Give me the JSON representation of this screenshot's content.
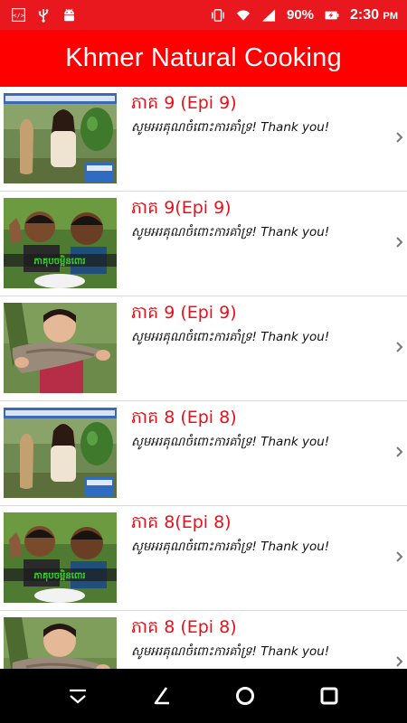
{
  "status_bar": {
    "battery_percent": "90%",
    "time": "2:30",
    "ampm": "PM",
    "icons": [
      "code-icon",
      "usb-icon",
      "android-icon",
      "vibrate-icon",
      "wifi-icon",
      "signal-icon",
      "battery-charging-icon"
    ]
  },
  "app_bar": {
    "title": "Khmer Natural Cooking"
  },
  "colors": {
    "status_bar": "#e8181e",
    "app_bar": "#fe0000",
    "title_text": "#e8101a"
  },
  "episodes": [
    {
      "title": "ភាគ 9 (Epi 9)",
      "subtitle": "សូមអរគុណចំពោះការគាំទ្រ! Thank you!",
      "thumbnail": "woman-papaya"
    },
    {
      "title": "ភាគ 9(Epi 9)",
      "subtitle": "សូមអរគុណចំពោះការគាំទ្រ! Thank you!",
      "thumbnail": "two-boys"
    },
    {
      "title": "ភាគ 9 (Epi 9)",
      "subtitle": "សូមអរគុណចំពោះការគាំទ្រ! Thank you!",
      "thumbnail": "woman-fish"
    },
    {
      "title": "ភាគ 8 (Epi 8)",
      "subtitle": "សូមអរគុណចំពោះការគាំទ្រ! Thank you!",
      "thumbnail": "woman-papaya"
    },
    {
      "title": "ភាគ 8(Epi 8)",
      "subtitle": "សូមអរគុណចំពោះការគាំទ្រ! Thank you!",
      "thumbnail": "two-boys"
    },
    {
      "title": "ភាគ 8 (Epi 8)",
      "subtitle": "សូមអរគុណចំពោះការគាំទ្រ! Thank you!",
      "thumbnail": "woman-fish"
    }
  ],
  "nav_bar": {
    "icons": [
      "hide-keyboard-icon",
      "back-icon",
      "home-icon",
      "recents-icon"
    ]
  }
}
